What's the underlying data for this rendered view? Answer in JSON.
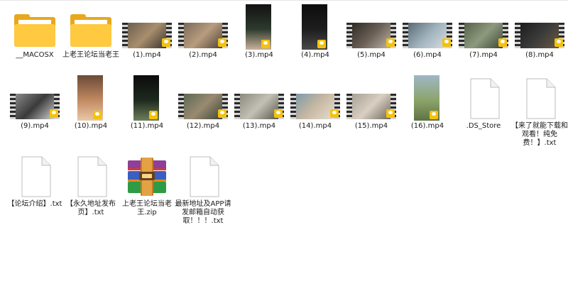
{
  "window": {
    "view": "large-icons"
  },
  "colors": {
    "folder_front": "#ffc940",
    "folder_back": "#e8a81c",
    "badge": "#f4c20d",
    "label_text": "#1a1a1a"
  },
  "files": [
    {
      "name": "__MACOSX",
      "kind": "folder",
      "icon": "folder-icon"
    },
    {
      "name": "上老王论坛当老王",
      "kind": "folder",
      "icon": "folder-icon"
    },
    {
      "name": "(1).mp4",
      "kind": "video",
      "icon": "video-thumbnail-icon",
      "badge": "Player",
      "colors": [
        "#6b5e4e",
        "#a88e6d",
        "#3b352e"
      ]
    },
    {
      "name": "(2).mp4",
      "kind": "video",
      "icon": "video-thumbnail-icon",
      "badge": "Player",
      "colors": [
        "#7a6a58",
        "#b89c7e",
        "#4d4237"
      ]
    },
    {
      "name": "(3).mp4",
      "kind": "video-portrait",
      "icon": "video-thumbnail-icon",
      "badge": "Player",
      "colors": [
        "#121212",
        "#2d3a2e",
        "#c9b29a"
      ]
    },
    {
      "name": "(4).mp4",
      "kind": "video-portrait",
      "icon": "video-thumbnail-icon",
      "badge": "Player",
      "colors": [
        "#0d0d0d",
        "#1d1d1d",
        "#4a4a4a"
      ]
    },
    {
      "name": "(5).mp4",
      "kind": "video",
      "icon": "video-thumbnail-icon",
      "badge": "Player",
      "colors": [
        "#2f2a26",
        "#6a5f55",
        "#bfb3a6"
      ]
    },
    {
      "name": "(6).mp4",
      "kind": "video",
      "icon": "video-thumbnail-icon",
      "badge": "Player",
      "colors": [
        "#5a6a74",
        "#9fb2bc",
        "#d8dde0"
      ]
    },
    {
      "name": "(7).mp4",
      "kind": "video",
      "icon": "video-thumbnail-icon",
      "badge": "Player",
      "colors": [
        "#55604a",
        "#8e9a7e",
        "#3d4536"
      ]
    },
    {
      "name": "(8).mp4",
      "kind": "video",
      "icon": "video-thumbnail-icon",
      "badge": "Player",
      "colors": [
        "#1c1c1c",
        "#3a3a3a",
        "#6b5a44"
      ]
    },
    {
      "name": "(9).mp4",
      "kind": "video",
      "icon": "video-thumbnail-icon",
      "badge": "Player",
      "colors": [
        "#8a8a8a",
        "#3a3a3a",
        "#cfcfcf"
      ]
    },
    {
      "name": "(10).mp4",
      "kind": "video-portrait",
      "icon": "video-thumbnail-icon",
      "badge": "Player",
      "colors": [
        "#6a4a36",
        "#c28a62",
        "#e9c9a8"
      ]
    },
    {
      "name": "(11).mp4",
      "kind": "video-portrait",
      "icon": "video-thumbnail-icon",
      "badge": "Player",
      "colors": [
        "#0b0b0b",
        "#1e2a1e",
        "#6e7f5a"
      ]
    },
    {
      "name": "(12).mp4",
      "kind": "video",
      "icon": "video-thumbnail-icon",
      "badge": "Player",
      "colors": [
        "#5b6a52",
        "#9a8a72",
        "#3b4536"
      ]
    },
    {
      "name": "(13).mp4",
      "kind": "video",
      "icon": "video-thumbnail-icon",
      "badge": "Player",
      "colors": [
        "#8c8a7e",
        "#c3c0b4",
        "#5a584e"
      ]
    },
    {
      "name": "(14).mp4",
      "kind": "video",
      "icon": "video-thumbnail-icon",
      "badge": "Player",
      "colors": [
        "#7e9aa8",
        "#c8b8a2",
        "#e4ddd2"
      ]
    },
    {
      "name": "(15).mp4",
      "kind": "video",
      "icon": "video-thumbnail-icon",
      "badge": "Player",
      "colors": [
        "#a8a096",
        "#d9cfc2",
        "#6e665c"
      ]
    },
    {
      "name": "(16).mp4",
      "kind": "video-portrait",
      "icon": "video-thumbnail-icon",
      "badge": "Player",
      "colors": [
        "#9fb7c6",
        "#8ca46a",
        "#5e7344"
      ]
    },
    {
      "name": ".DS_Store",
      "kind": "document",
      "icon": "document-icon"
    },
    {
      "name": "【来了就能下载和观看！纯免费！】.txt",
      "kind": "document",
      "icon": "text-file-icon"
    },
    {
      "name": "【论坛介绍】.txt",
      "kind": "document",
      "icon": "text-file-icon"
    },
    {
      "name": "【永久地址发布页】.txt",
      "kind": "document",
      "icon": "text-file-icon"
    },
    {
      "name": "上老王论坛当老王.zip",
      "kind": "zip",
      "icon": "winrar-archive-icon"
    },
    {
      "name": "最新地址及APP请发邮箱自动获取！！！.txt",
      "kind": "document",
      "icon": "text-file-icon"
    }
  ]
}
